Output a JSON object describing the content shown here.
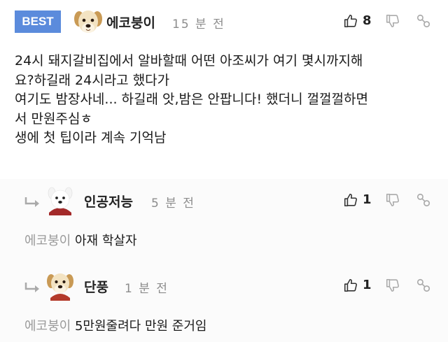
{
  "comments": [
    {
      "badge": "BEST",
      "author": "에코붕이",
      "time": "15 분 전",
      "likes": "8",
      "lines": [
        "24시 돼지갈비집에서 알바할때 어떤 아조씨가 여기 몇시까지해",
        "요?하길래 24시라고 했다가",
        "여기도 밤장사네... 하길래 앗,밤은 안팝니다! 했더니 껄껄껄하면",
        "서 만원주심ㅎ",
        "생에 첫 팁이라 계속 기억남"
      ]
    },
    {
      "author": "인공저능",
      "time": "5 분 전",
      "likes": "1",
      "mention": "에코붕이",
      "text": "아재 학살자"
    },
    {
      "author": "단풍",
      "time": "1 분 전",
      "likes": "1",
      "mention": "에코붕이",
      "text": "5만원줄려다 만원 준거임"
    }
  ],
  "icons": {
    "like": "thumbs-up-icon",
    "dislike": "thumbs-down-icon",
    "link": "link-icon",
    "reply": "reply-arrow-icon",
    "avatar": "puppy-avatar"
  },
  "colors": {
    "best_badge": "#5b8bdc",
    "muted": "#8c8c8c"
  }
}
